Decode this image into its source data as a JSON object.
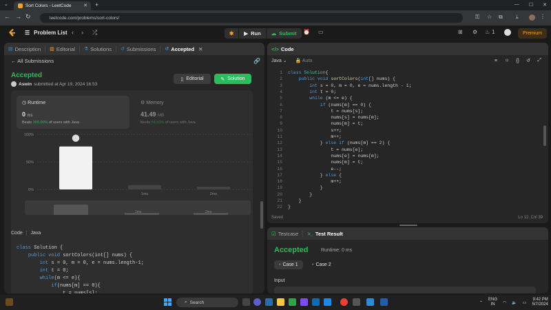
{
  "browser": {
    "tab_title": "Sort Colors - LeetCode",
    "url": "leetcode.com/problems/sort-colors/"
  },
  "header": {
    "problem_list": "Problem List",
    "run_label": "Run",
    "submit_label": "Submit",
    "notifications": "1",
    "premium_label": "Premium"
  },
  "left_panel": {
    "tabs": [
      {
        "label": "Description"
      },
      {
        "label": "Editorial"
      },
      {
        "label": "Solutions"
      },
      {
        "label": "Submissions"
      },
      {
        "label": "Accepted"
      }
    ],
    "all_submissions": "All Submissions",
    "status": "Accepted",
    "user": "Aswin",
    "submitted_at": "submitted at Apr 19, 2024 16:53",
    "editorial_btn": "Editorial",
    "solution_btn": "Solution",
    "runtime": {
      "title": "Runtime",
      "value": "0",
      "unit": "ms",
      "beats_prefix": "Beats",
      "beats_value": "100.00%",
      "beats_suffix": "of users with Java"
    },
    "memory": {
      "title": "Memory",
      "value": "41.49",
      "unit": "MB",
      "beats_prefix": "Beats",
      "beats_value": "58.60%",
      "beats_suffix": "of users with Java"
    },
    "code_header": "Code",
    "code_lang": "Java",
    "code_lines": [
      "class Solution {",
      "    public void sortColors(int[] nums) {",
      "        int s = 0, m = 0, e = nums.length-1;",
      "        int t = 0;",
      "        while(m <= e){",
      "            if(nums[m] == 0){",
      "                t = nums[s];"
    ]
  },
  "chart_data": {
    "type": "bar",
    "categories": [
      "0ms",
      "1ms",
      "2ms"
    ],
    "values": [
      78,
      8,
      5
    ],
    "y_ticks": [
      "100%",
      "50%",
      "0%"
    ],
    "ylim": [
      0,
      100
    ],
    "overview_labels": [
      "1ms",
      "2ms"
    ]
  },
  "code_panel": {
    "title": "Code",
    "language": "Java",
    "mode": "Auto",
    "lines": [
      [
        [
          "kw",
          "class "
        ],
        [
          "ty",
          "Solution"
        ],
        [
          "",
          "{"
        ]
      ],
      [
        [
          "kw",
          "    public void "
        ],
        [
          "fn",
          "sortColors"
        ],
        [
          "",
          "("
        ],
        [
          "kw",
          "int"
        ],
        [
          "",
          "[] nums) {"
        ]
      ],
      [
        [
          "kw",
          "        int "
        ],
        [
          "",
          "s = "
        ],
        [
          "num",
          "0"
        ],
        [
          "",
          ", m = "
        ],
        [
          "num",
          "0"
        ],
        [
          "",
          ", e = nums.length - "
        ],
        [
          "num",
          "1"
        ],
        [
          "",
          ";"
        ]
      ],
      [
        [
          "kw",
          "        int "
        ],
        [
          "",
          "t = "
        ],
        [
          "num",
          "0"
        ],
        [
          "",
          ";"
        ]
      ],
      [
        [
          "kw",
          "        while "
        ],
        [
          "",
          "(m <= e) {"
        ]
      ],
      [
        [
          "kw",
          "            if "
        ],
        [
          "",
          "(nums[m] == "
        ],
        [
          "num",
          "0"
        ],
        [
          "",
          ") {"
        ]
      ],
      [
        [
          "",
          "                t = nums[s];"
        ]
      ],
      [
        [
          "",
          "                nums[s] = nums[m];"
        ]
      ],
      [
        [
          "",
          "                nums[m] = t;"
        ]
      ],
      [
        [
          "",
          "                s++;"
        ]
      ],
      [
        [
          "",
          "                m++;"
        ]
      ],
      [
        [
          "",
          "            } "
        ],
        [
          "kw",
          "else if "
        ],
        [
          "",
          "(nums[m] == "
        ],
        [
          "num",
          "2"
        ],
        [
          "",
          ") {"
        ]
      ],
      [
        [
          "",
          "                t = nums[e];"
        ]
      ],
      [
        [
          "",
          "                nums[e] = nums[m];"
        ]
      ],
      [
        [
          "",
          "                nums[m] = t;"
        ]
      ],
      [
        [
          "",
          "                e--;"
        ]
      ],
      [
        [
          "",
          "            } "
        ],
        [
          "kw",
          "else "
        ],
        [
          "",
          "{"
        ]
      ],
      [
        [
          "",
          "                m++;"
        ]
      ],
      [
        [
          "",
          "            }"
        ]
      ],
      [
        [
          "",
          "        }"
        ]
      ],
      [
        [
          "",
          "    }"
        ]
      ],
      [
        [
          "",
          "}"
        ]
      ]
    ],
    "saved": "Saved",
    "cursor": "Ln 12, Col 39"
  },
  "test_panel": {
    "testcase_tab": "Testcase",
    "result_tab": "Test Result",
    "status": "Accepted",
    "runtime": "Runtime: 0 ms",
    "case1": "Case 1",
    "case2": "Case 2",
    "input_label": "Input"
  },
  "taskbar": {
    "search": "Search",
    "lang": "ENG",
    "region": "IN",
    "time": "9:42 PM",
    "date": "5/7/2024"
  }
}
